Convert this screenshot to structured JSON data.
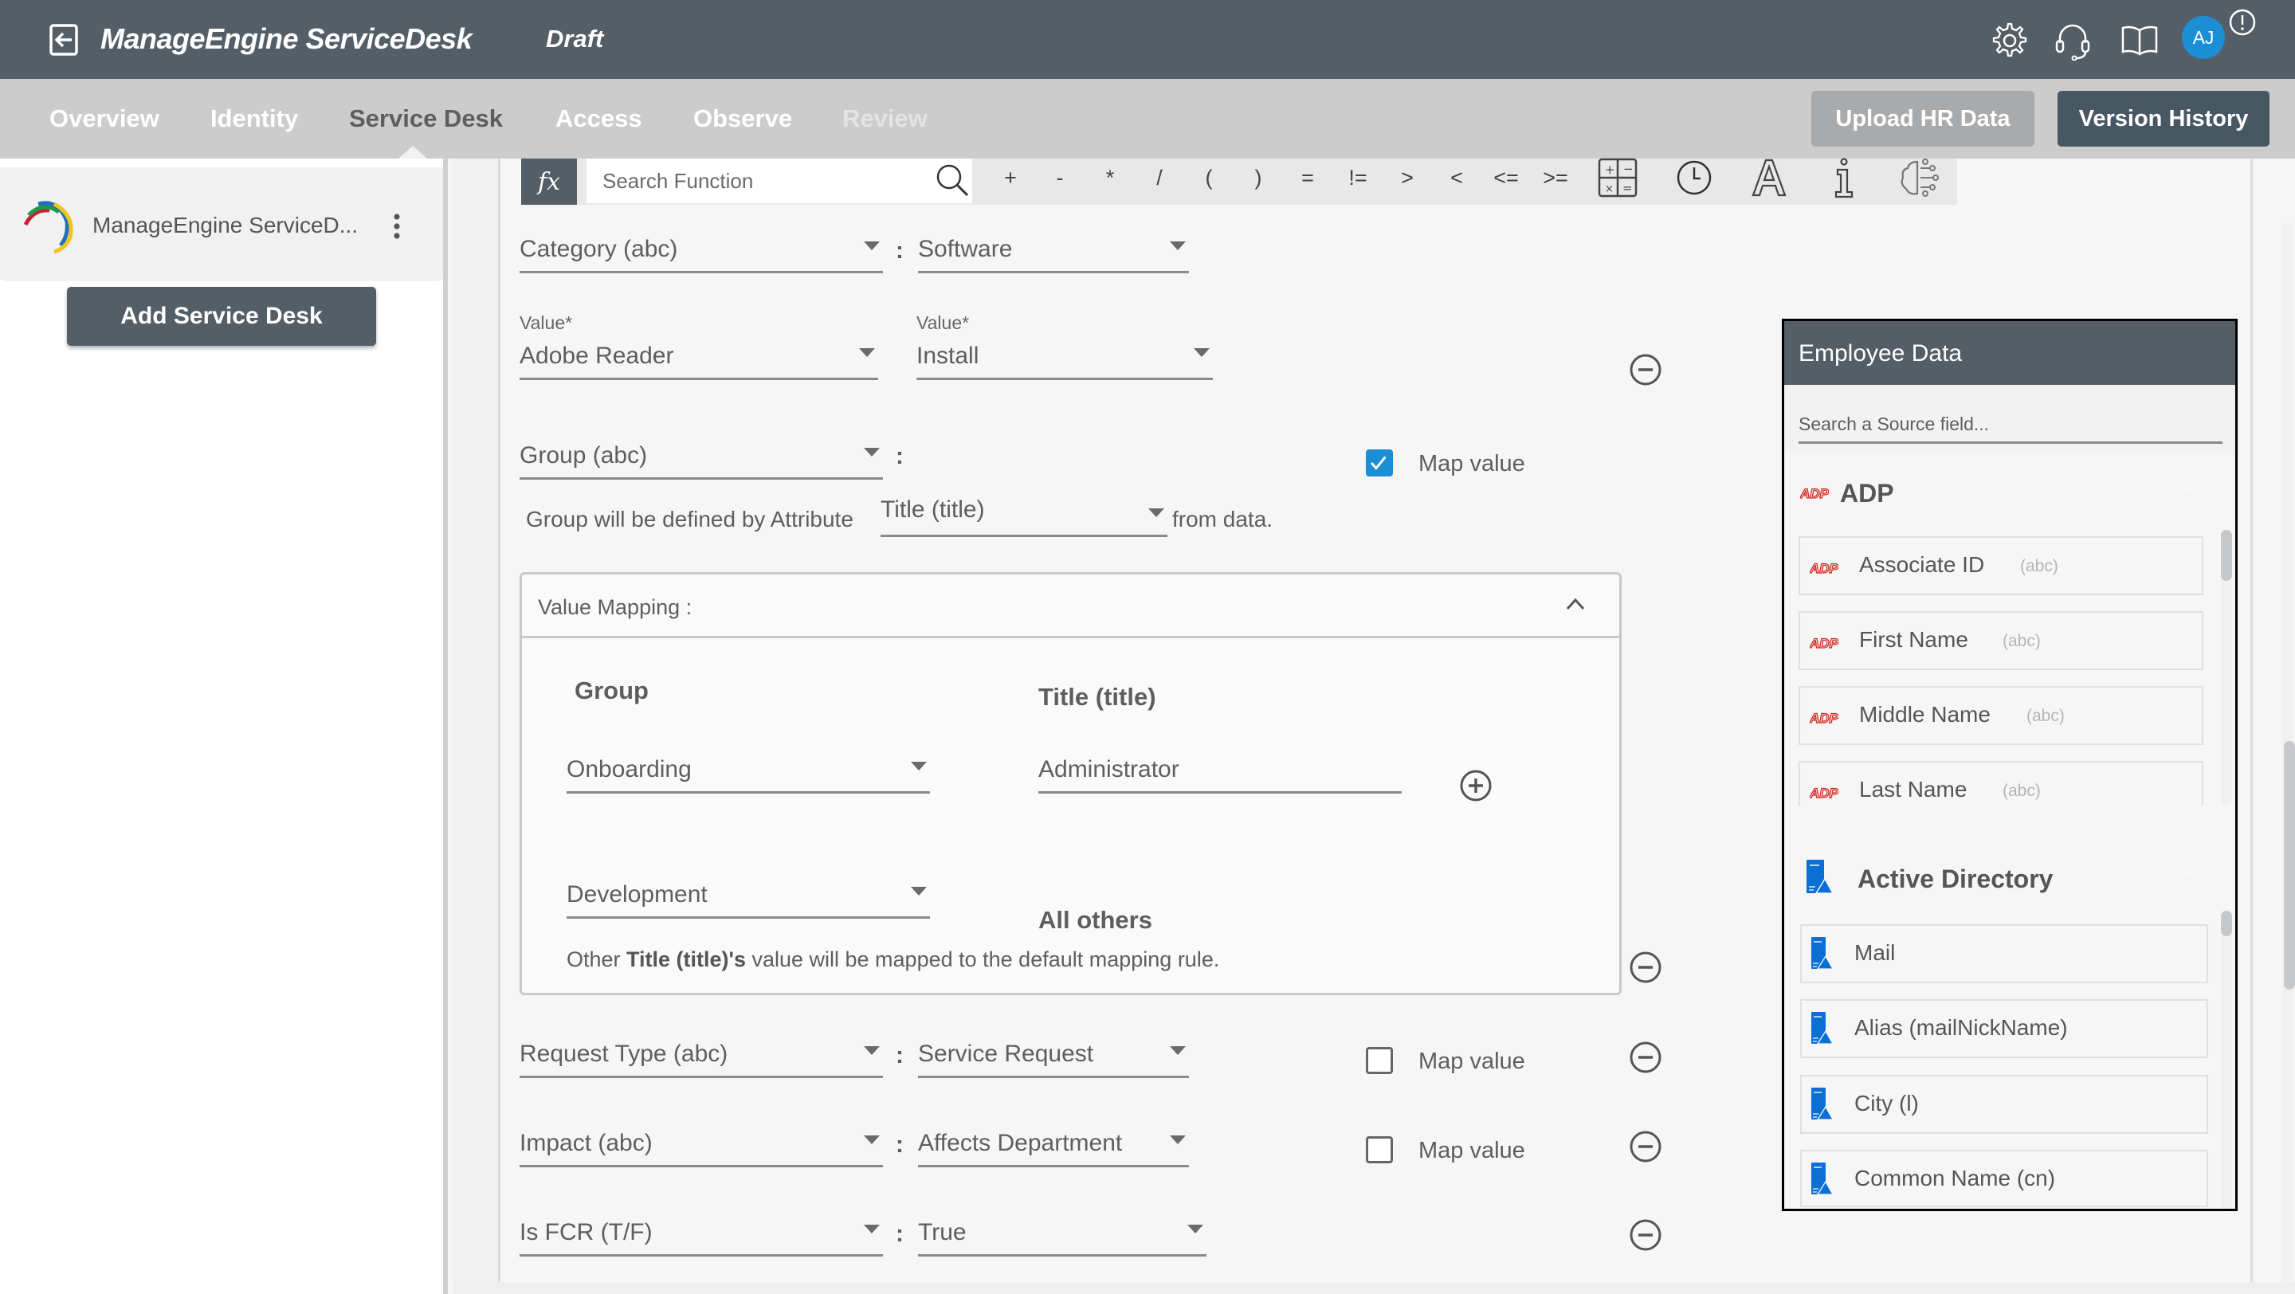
{
  "header": {
    "app_title": "ManageEngine ServiceDesk",
    "status": "Draft",
    "avatar_initials": "AJ",
    "icons": [
      "back-icon",
      "gear-icon",
      "headset-icon",
      "book-icon",
      "alert-icon"
    ]
  },
  "nav": {
    "tabs": [
      {
        "label": "Overview",
        "state": "default"
      },
      {
        "label": "Identity",
        "state": "default"
      },
      {
        "label": "Service Desk",
        "state": "active"
      },
      {
        "label": "Access",
        "state": "default"
      },
      {
        "label": "Observe",
        "state": "default"
      },
      {
        "label": "Review",
        "state": "disabled"
      }
    ],
    "upload_label": "Upload HR Data",
    "version_label": "Version History"
  },
  "sidebar": {
    "item_name": "ManageEngine ServiceD...",
    "add_label": "Add Service Desk"
  },
  "toolbar": {
    "fx_label": "fx",
    "search_placeholder": "Search Function",
    "operators": [
      "+",
      "-",
      "*",
      "/",
      "(",
      ")",
      "=",
      "!=",
      ">",
      "<",
      "<=",
      ">="
    ],
    "icons": [
      "calculator-icon",
      "clock-icon",
      "text-icon",
      "info-icon",
      "ai-brain-icon"
    ]
  },
  "form": {
    "category": {
      "field": "Category (abc)",
      "value": "Software"
    },
    "sub_values": {
      "label1": "Value*",
      "value1": "Adobe Reader",
      "label2": "Value*",
      "value2": "Install"
    },
    "group": {
      "field": "Group (abc)",
      "map_value_label": "Map value",
      "map_value_checked": true,
      "attr_prefix": "Group will be defined by Attribute",
      "attr_value": "Title (title)",
      "attr_suffix": "from data."
    },
    "value_mapping": {
      "title": "Value Mapping :",
      "col_group": "Group",
      "col_attr": "Title (title)",
      "rows": [
        {
          "group": "Onboarding",
          "attr": "Administrator"
        },
        {
          "group": "Development",
          "attr": "All others"
        }
      ],
      "note_prefix": "Other ",
      "note_bold": "Title (title)'s",
      "note_suffix": " value will be mapped to the default mapping rule."
    },
    "request_type": {
      "field": "Request Type (abc)",
      "value": "Service Request",
      "map_value_label": "Map value",
      "map_value_checked": false
    },
    "impact": {
      "field": "Impact (abc)",
      "value": "Affects Department",
      "map_value_label": "Map value",
      "map_value_checked": false
    },
    "is_fcr": {
      "field": "Is FCR (T/F)",
      "value": "True"
    },
    "colon": ":"
  },
  "employee_panel": {
    "title": "Employee Data",
    "search_placeholder": "Search a Source field...",
    "groups": [
      {
        "name": "ADP",
        "brand_color": "#d0271d",
        "fields": [
          {
            "name": "Associate ID",
            "type": "(abc)"
          },
          {
            "name": "First Name",
            "type": "(abc)"
          },
          {
            "name": "Middle Name",
            "type": "(abc)"
          },
          {
            "name": "Last Name",
            "type": "(abc)"
          }
        ]
      },
      {
        "name": "Active Directory",
        "brand_color": "#0b6fd6",
        "fields": [
          {
            "name": "Mail"
          },
          {
            "name": "Alias (mailNickName)"
          },
          {
            "name": "City (l)"
          },
          {
            "name": "Common Name (cn)"
          }
        ]
      }
    ]
  },
  "colors": {
    "header_bg": "#545e67",
    "nav_bg": "#cccccc",
    "accent_blue": "#1b8ed6",
    "version_btn": "#475863",
    "upload_btn": "#a9aaab"
  }
}
